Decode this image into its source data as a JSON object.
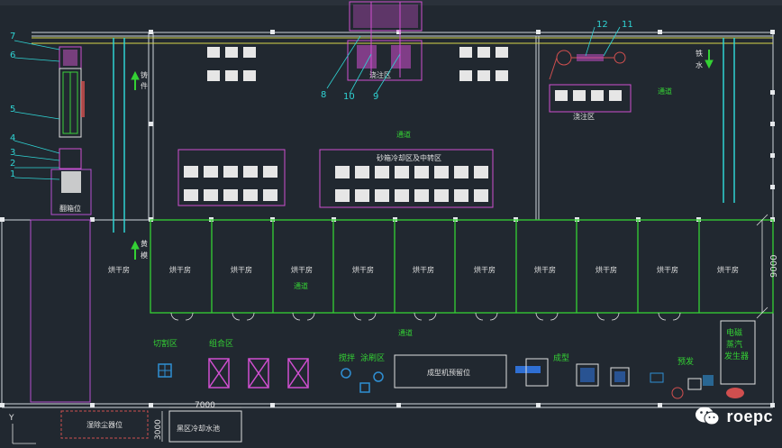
{
  "title_bar": "",
  "dimensions": {
    "width_right": "9000",
    "bottom_width": "7000",
    "bottom_height": "3000"
  },
  "callouts": [
    "7",
    "6",
    "5",
    "4",
    "3",
    "2",
    "1",
    "8",
    "10",
    "9",
    "12",
    "11"
  ],
  "areas": {
    "casting_pos": "翻箱位",
    "pouring": "浇注区",
    "shakeout": "浇注区",
    "sand_cooling": "砂箱冷却区及中转区",
    "drying_room": "烘干房",
    "channel": "通道",
    "cutting": "切割区",
    "assembly": "组合区",
    "mixing": "搅拌",
    "coating": "涂刷区",
    "molding_reserve": "成型机预留位",
    "molding": "成型",
    "preheat": "预发",
    "steam_gen": [
      "电磁",
      "蒸汽",
      "发生器"
    ],
    "dust": "湿除尘器位",
    "cooling_pool": "黑区冷却水池",
    "iron_water": [
      "铁",
      "水"
    ],
    "casting_left": [
      "铸",
      "件"
    ],
    "sand_left": [
      "黄",
      "模"
    ]
  },
  "watermark": {
    "label": "roepc",
    "icon": "wechat-icon"
  },
  "axis": "Y"
}
